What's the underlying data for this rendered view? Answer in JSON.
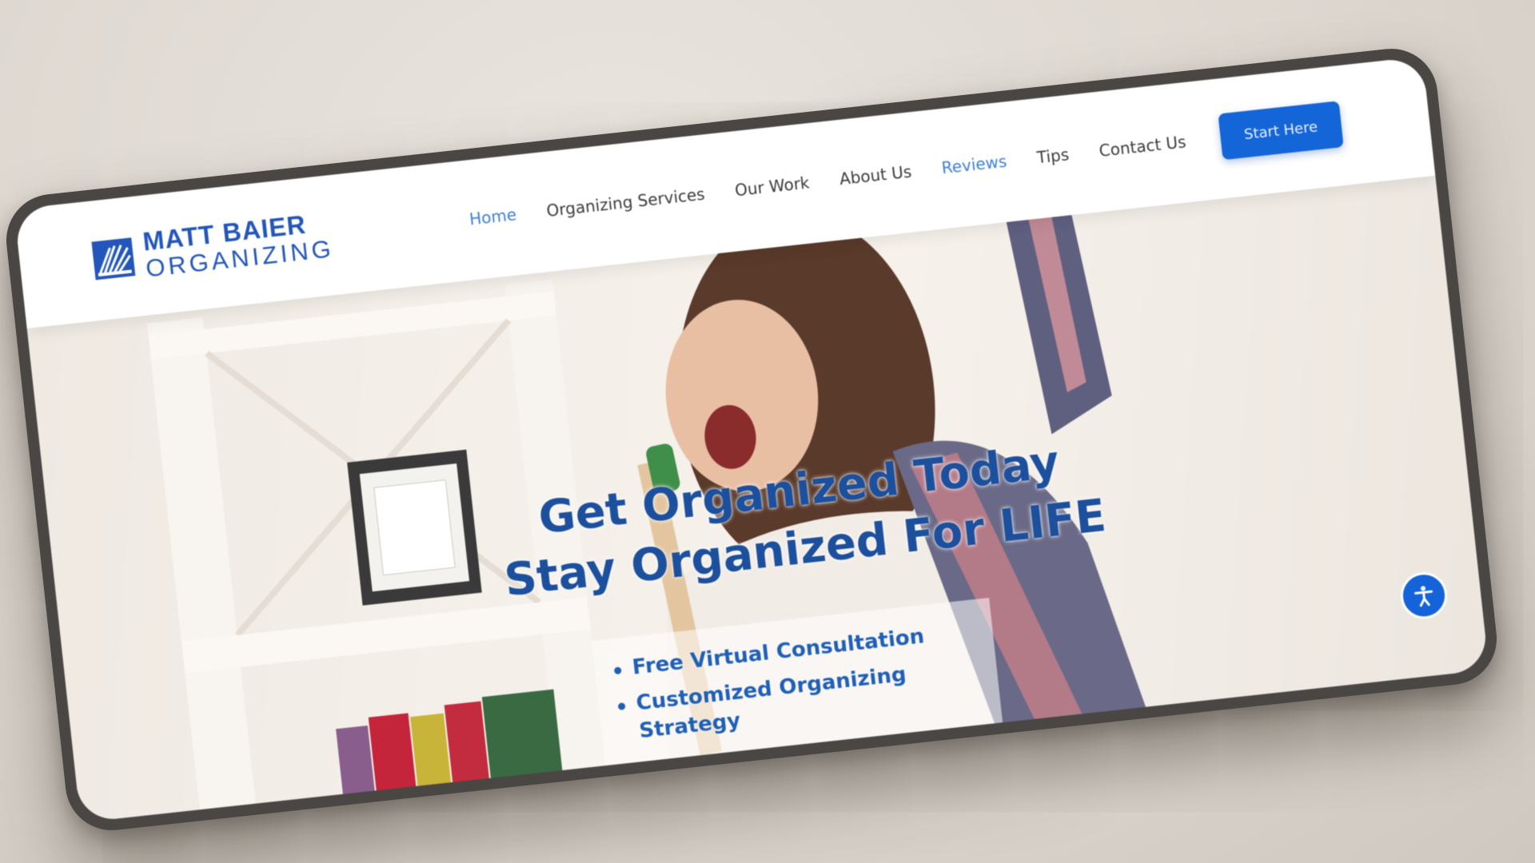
{
  "brand": {
    "line1": "MATT BAIER",
    "line2": "ORGANIZING",
    "color": "#2356b8"
  },
  "nav": {
    "items": [
      {
        "label": "Home",
        "active": true
      },
      {
        "label": "Organizing Services"
      },
      {
        "label": "Our Work"
      },
      {
        "label": "About Us"
      },
      {
        "label": "Reviews"
      },
      {
        "label": "Tips"
      },
      {
        "label": "Contact Us"
      }
    ],
    "cta": "Start Here"
  },
  "hero": {
    "headline_line1": "Get Organized Today",
    "headline_line2": "Stay Organized For LIFE",
    "bullets": [
      "Free Virtual Consultation",
      "Customized Organizing Strategy"
    ]
  },
  "icons": {
    "accessibility": "accessibility-icon",
    "logo": "logo-icon"
  },
  "colors": {
    "accent": "#1466d8",
    "headline": "#1c4f9c",
    "nav_active": "#3d7fd6"
  }
}
